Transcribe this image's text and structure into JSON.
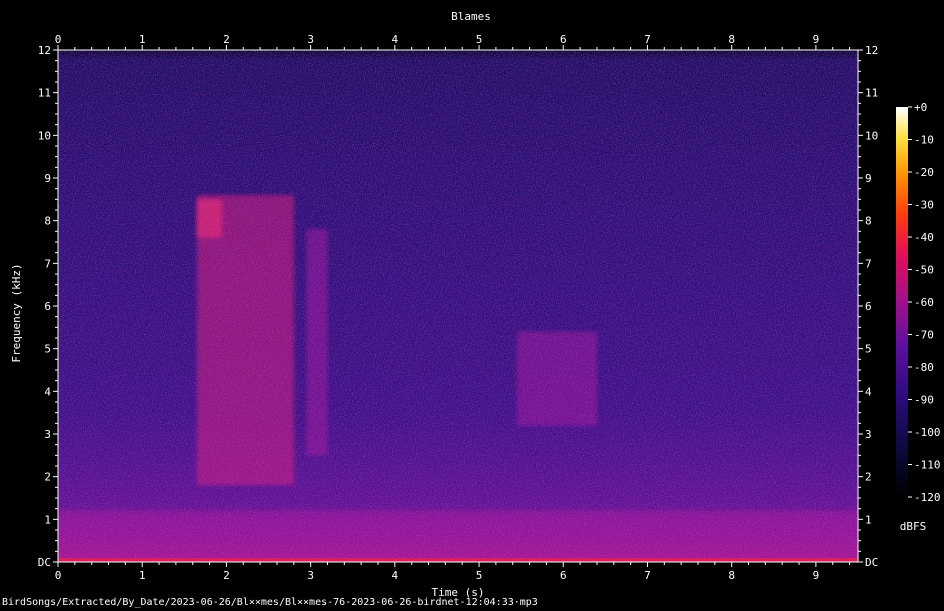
{
  "chart_data": {
    "type": "heatmap",
    "title": "Blames",
    "xlabel": "Time (s)",
    "ylabel": "Frequency (kHz)",
    "xlim": [
      0,
      9.5
    ],
    "ylim": [
      0,
      12
    ],
    "x_ticks": [
      "0",
      "1",
      "2",
      "3",
      "4",
      "5",
      "6",
      "7",
      "8",
      "9"
    ],
    "y_ticks": [
      "DC",
      "1",
      "2",
      "3",
      "4",
      "5",
      "6",
      "7",
      "8",
      "9",
      "10",
      "11",
      "12"
    ],
    "colorbar": {
      "label": "dBFS",
      "ticks": [
        "+0",
        "-10",
        "-20",
        "-30",
        "-40",
        "-50",
        "-60",
        "-70",
        "-80",
        "-90",
        "-100",
        "-110",
        "-120"
      ],
      "range": [
        -120,
        0
      ]
    },
    "signal_regions": [
      {
        "t": [
          1.65,
          2.8
        ],
        "f": [
          1.8,
          8.6
        ],
        "level_dbfs": -70
      },
      {
        "t": [
          1.65,
          1.95
        ],
        "f": [
          7.6,
          8.5
        ],
        "level_dbfs": -60
      },
      {
        "t": [
          2.95,
          3.2
        ],
        "f": [
          2.5,
          7.8
        ],
        "level_dbfs": -78
      },
      {
        "t": [
          5.45,
          6.4
        ],
        "f": [
          3.2,
          5.4
        ],
        "level_dbfs": -75
      },
      {
        "t": [
          0,
          9.5
        ],
        "f": [
          0,
          1.2
        ],
        "level_dbfs": -80
      }
    ],
    "colors": {
      "background": "#000000",
      "axis": "#ffffff",
      "low": "#0b0a3c",
      "high": "#ffffff"
    }
  },
  "footer": {
    "file_path": "BirdSongs/Extracted/By_Date/2023-06-26/Bl××mes/Bl××mes-76-2023-06-26-birdnet-12:04:33·mp3"
  }
}
